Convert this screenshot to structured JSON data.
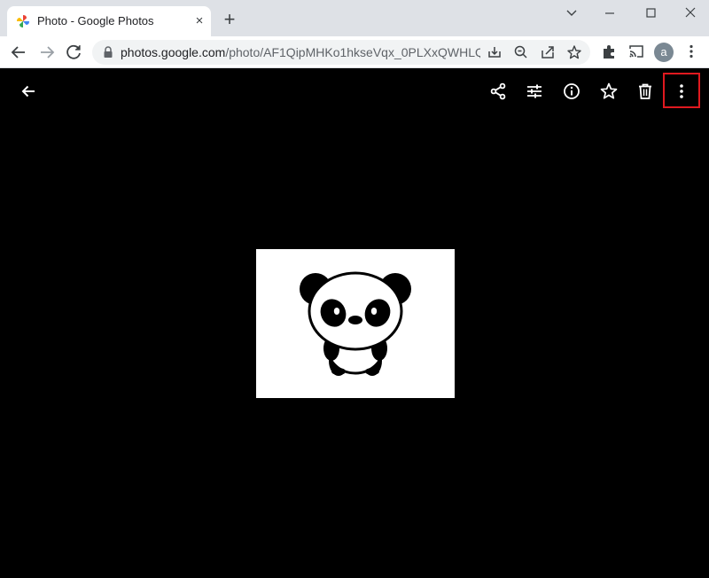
{
  "browser": {
    "tab": {
      "title": "Photo - Google Photos",
      "close_label": "×"
    },
    "new_tab_label": "+",
    "address": {
      "host": "photos.google.com",
      "path": "/photo/AF1QipMHKo1hkseVqx_0PLXxQWHLQ..."
    },
    "profile_initial": "a"
  },
  "viewer": {
    "icons": [
      "back-arrow-icon",
      "share-icon",
      "edit-icon",
      "info-icon",
      "favorite-star-icon",
      "delete-icon",
      "more-options-icon"
    ],
    "highlight_color": "#e0191f"
  },
  "photo": {
    "subject": "panda",
    "background": "#ffffff"
  }
}
